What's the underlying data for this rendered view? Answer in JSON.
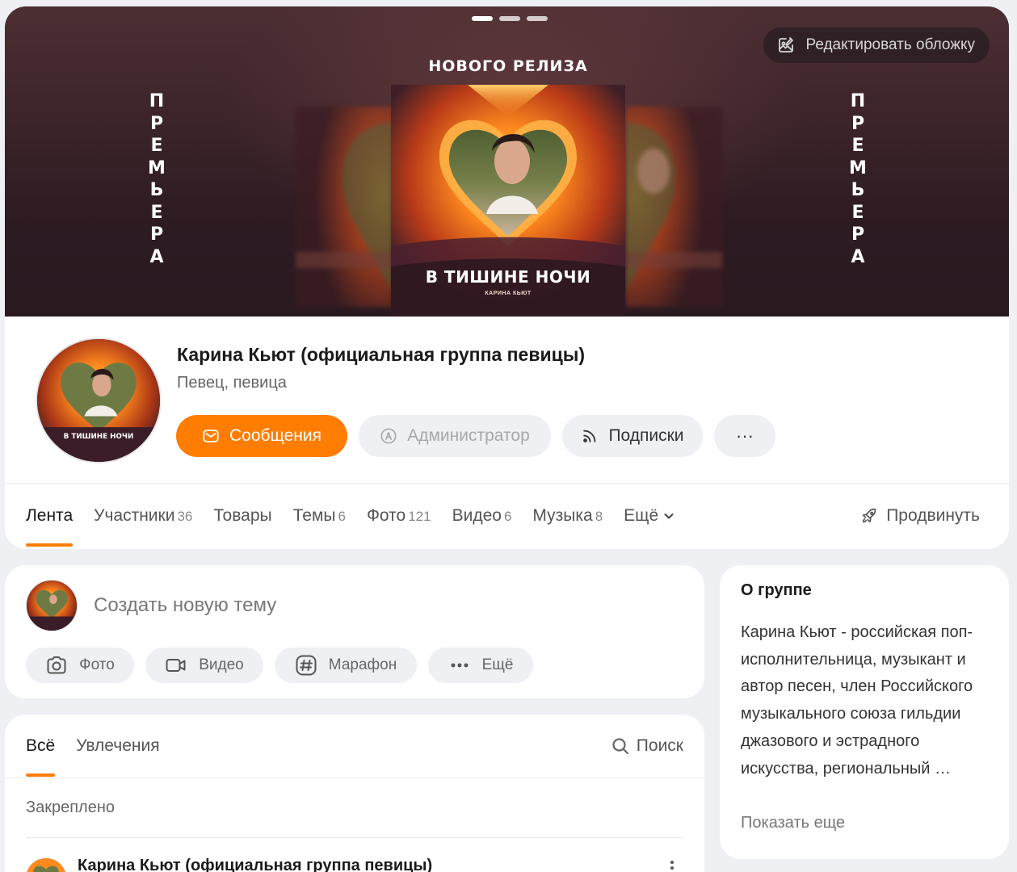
{
  "cover": {
    "edit_label": "Редактировать обложку",
    "release_title": "НОВОГО РЕЛИЗА",
    "premiere_letters": [
      "П",
      "Р",
      "Е",
      "М",
      "Ь",
      "Е",
      "Р",
      "А"
    ],
    "album_title": "В ТИШИНЕ НОЧИ",
    "album_artist": "КАРИНА КЬЮТ"
  },
  "profile": {
    "name": "Карина Кьют (официальная группа певицы)",
    "subtitle": "Певец, певица",
    "actions": {
      "messages": "Сообщения",
      "admin": "Администратор",
      "subscriptions": "Подписки",
      "more": "···"
    },
    "tabs": [
      {
        "label": "Лента",
        "count": ""
      },
      {
        "label": "Участники",
        "count": "36"
      },
      {
        "label": "Товары",
        "count": ""
      },
      {
        "label": "Темы",
        "count": "6"
      },
      {
        "label": "Фото",
        "count": "121"
      },
      {
        "label": "Видео",
        "count": "6"
      },
      {
        "label": "Музыка",
        "count": "8"
      },
      {
        "label": "Ещё",
        "count": ""
      }
    ],
    "promote": "Продвинуть"
  },
  "create": {
    "placeholder": "Создать новую тему",
    "chips": {
      "photo": "Фото",
      "video": "Видео",
      "marathon": "Марафон",
      "more": "Ещё"
    }
  },
  "feed": {
    "tabs": [
      "Всё",
      "Увлечения"
    ],
    "search": "Поиск",
    "pinned": "Закреплено",
    "post_author": "Карина Кьют (официальная группа певицы)"
  },
  "about": {
    "title": "О группе",
    "text": "Карина Кьют - российская поп-исполнительница, музыкант и автор песен, член Российского музыкального союза гильдии джазового и эстрадного искусства, региональный …",
    "show_more": "Показать еще"
  },
  "colors": {
    "accent": "#ff7d00",
    "background": "#eef0f3",
    "cover_dark": "#2d1b22"
  }
}
